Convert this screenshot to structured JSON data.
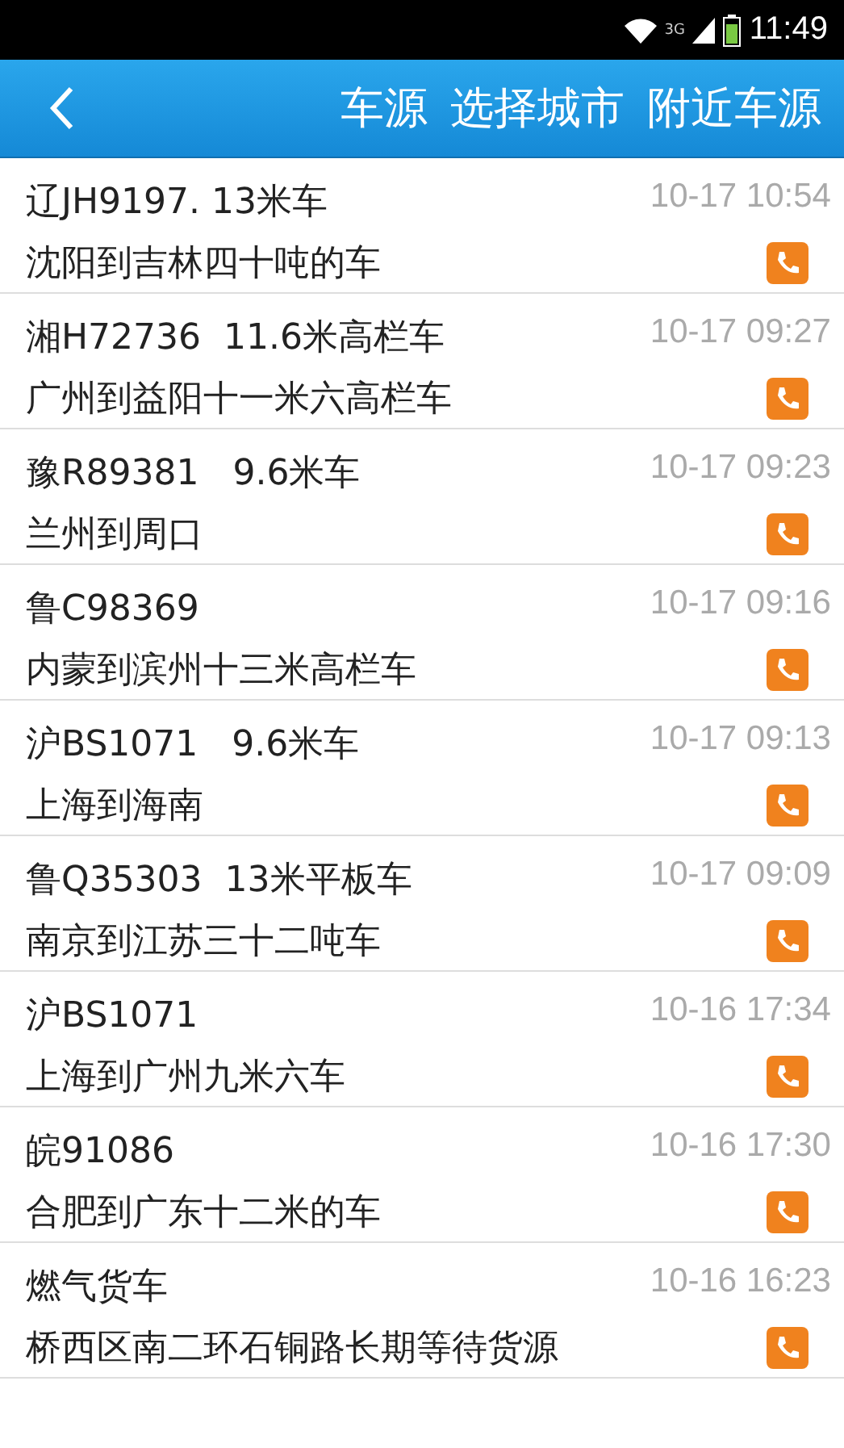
{
  "status_bar": {
    "network": "3G",
    "time": "11:49"
  },
  "header": {
    "tabs": [
      "车源",
      "选择城市",
      "附近车源"
    ]
  },
  "listings": [
    {
      "vehicle": "辽JH9197. 13米车",
      "time": "10-17 10:54",
      "route": "沈阳到吉林四十吨的车"
    },
    {
      "vehicle": "湘H72736  11.6米高栏车",
      "time": "10-17 09:27",
      "route": "广州到益阳十一米六高栏车"
    },
    {
      "vehicle": "豫R89381   9.6米车",
      "time": "10-17 09:23",
      "route": "兰州到周口"
    },
    {
      "vehicle": "鲁C98369",
      "time": "10-17 09:16",
      "route": "内蒙到滨州十三米高栏车"
    },
    {
      "vehicle": "沪BS1071   9.6米车",
      "time": "10-17 09:13",
      "route": "上海到海南"
    },
    {
      "vehicle": "鲁Q35303  13米平板车",
      "time": "10-17 09:09",
      "route": "南京到江苏三十二吨车"
    },
    {
      "vehicle": "沪BS1071",
      "time": "10-16 17:34",
      "route": "上海到广州九米六车"
    },
    {
      "vehicle": "皖91086",
      "time": "10-16 17:30",
      "route": "合肥到广东十二米的车"
    },
    {
      "vehicle": "燃气货车",
      "time": "10-16 16:23",
      "route": "桥西区南二环石铜路长期等待货源"
    }
  ]
}
